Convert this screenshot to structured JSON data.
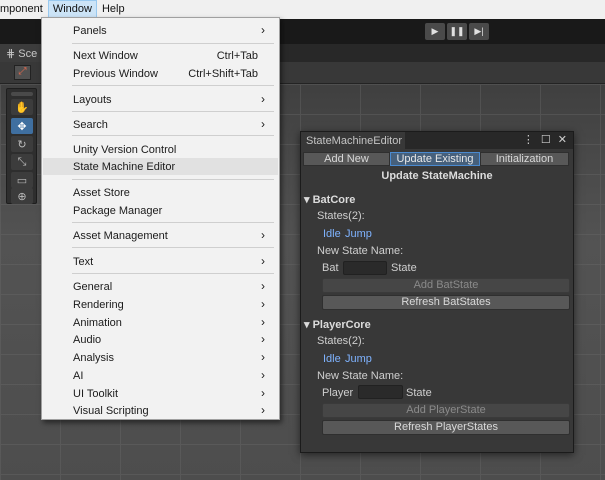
{
  "menubar": {
    "component": "mponent",
    "window": "Window",
    "help": "Help"
  },
  "toolbar": {
    "play": "▶",
    "pause": "❚❚",
    "step": "▶|"
  },
  "scene": {
    "tab_label": "Sce"
  },
  "window_menu": {
    "items": [
      {
        "label": "Panels",
        "shortcut": "",
        "submenu": true
      },
      {
        "label": "Next Window",
        "shortcut": "Ctrl+Tab",
        "submenu": false
      },
      {
        "label": "Previous Window",
        "shortcut": "Ctrl+Shift+Tab",
        "submenu": false
      },
      {
        "label": "Layouts",
        "shortcut": "",
        "submenu": true
      },
      {
        "label": "Search",
        "shortcut": "",
        "submenu": true
      },
      {
        "label": "Unity Version Control",
        "shortcut": "",
        "submenu": false
      },
      {
        "label": "State Machine Editor",
        "shortcut": "",
        "submenu": false
      },
      {
        "label": "Asset Store",
        "shortcut": "",
        "submenu": false
      },
      {
        "label": "Package Manager",
        "shortcut": "",
        "submenu": false
      },
      {
        "label": "Asset Management",
        "shortcut": "",
        "submenu": true
      },
      {
        "label": "Text",
        "shortcut": "",
        "submenu": true
      },
      {
        "label": "General",
        "shortcut": "",
        "submenu": true
      },
      {
        "label": "Rendering",
        "shortcut": "",
        "submenu": true
      },
      {
        "label": "Animation",
        "shortcut": "",
        "submenu": true
      },
      {
        "label": "Audio",
        "shortcut": "",
        "submenu": true
      },
      {
        "label": "Analysis",
        "shortcut": "",
        "submenu": true
      },
      {
        "label": "AI",
        "shortcut": "",
        "submenu": true
      },
      {
        "label": "UI Toolkit",
        "shortcut": "",
        "submenu": true
      },
      {
        "label": "Visual Scripting",
        "shortcut": "",
        "submenu": true
      }
    ],
    "arrow": "›"
  },
  "sme": {
    "title": "StateMachineEditor",
    "icons": {
      "menu": "⋮",
      "maximize": "☐",
      "close": "✕"
    },
    "tabs": [
      "Add New",
      "Update Existing",
      "Initialization"
    ],
    "active_tab": "Update Existing",
    "heading": "Update StateMachine",
    "cores": [
      {
        "name": "BatCore",
        "states_label": "States(2):",
        "states": [
          "Idle",
          "Jump"
        ],
        "new_state_label": "New State Name:",
        "prefix": "Bat",
        "input_value": "",
        "suffix": "State",
        "add_button": "Add BatState",
        "refresh_button": "Refresh BatStates"
      },
      {
        "name": "PlayerCore",
        "states_label": "States(2):",
        "states": [
          "Idle",
          "Jump"
        ],
        "new_state_label": "New State Name:",
        "prefix": "Player",
        "input_value": "",
        "suffix": "State",
        "add_button": "Add PlayerState",
        "refresh_button": "Refresh PlayerStates"
      }
    ]
  }
}
